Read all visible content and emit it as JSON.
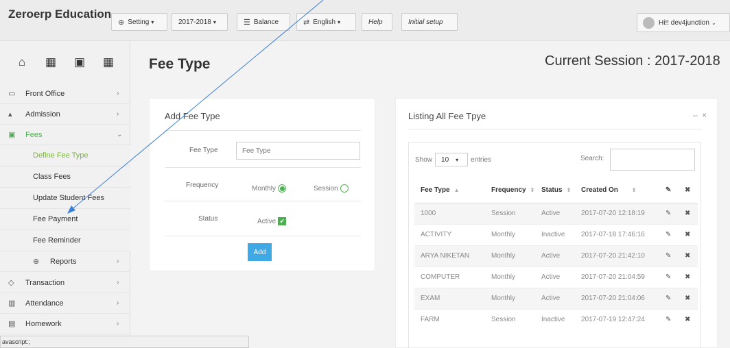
{
  "header": {
    "brand": "Zeroerp Education",
    "setting": "Setting",
    "session_select": "2017-2018",
    "balance": "Balance",
    "language": "English",
    "help": "Help",
    "initial_setup": "Initial setup",
    "user": "Hi!! dev4junction"
  },
  "sidebar": {
    "front_office": "Front Office",
    "admission": "Admission",
    "fees": "Fees",
    "define_fee_type": "Define Fee Type",
    "class_fees": "Class Fees",
    "update_student_fees": "Update Student Fees",
    "fee_payment": "Fee Payment",
    "fee_reminder": "Fee Reminder",
    "reports": "Reports",
    "transaction": "Transaction",
    "attendance": "Attendance",
    "homework": "Homework"
  },
  "page": {
    "title": "Fee Type",
    "session": "Current Session : 2017-2018"
  },
  "add_form": {
    "title": "Add Fee Type",
    "fee_type_label": "Fee Type",
    "fee_type_placeholder": "Fee Type",
    "frequency_label": "Frequency",
    "monthly": "Monthly",
    "session": "Session",
    "status_label": "Status",
    "active": "Active",
    "add_button": "Add"
  },
  "listing": {
    "title": "Listing All Fee Tpye",
    "show": "Show",
    "entries_value": "10",
    "entries": "entries",
    "search": "Search:",
    "columns": [
      "Fee Type",
      "Frequency",
      "Status",
      "Created On"
    ],
    "rows": [
      [
        "1000",
        "Session",
        "Active",
        "2017-07-20 12:18:19"
      ],
      [
        "ACTIVITY",
        "Monthly",
        "Inactive",
        "2017-07-18 17:46:16"
      ],
      [
        "ARYA NIKETAN",
        "Monthly",
        "Active",
        "2017-07-20 21:42:10"
      ],
      [
        "COMPUTER",
        "Monthly",
        "Active",
        "2017-07-20 21:04:59"
      ],
      [
        "EXAM",
        "Monthly",
        "Active",
        "2017-07-20 21:04:06"
      ],
      [
        "FARM",
        "Session",
        "Inactive",
        "2017-07-19 12:47:24"
      ]
    ]
  },
  "statusbar": "avascript:;",
  "colors": {
    "accent_green": "#4caf50",
    "add_button": "#3fa9e6"
  }
}
